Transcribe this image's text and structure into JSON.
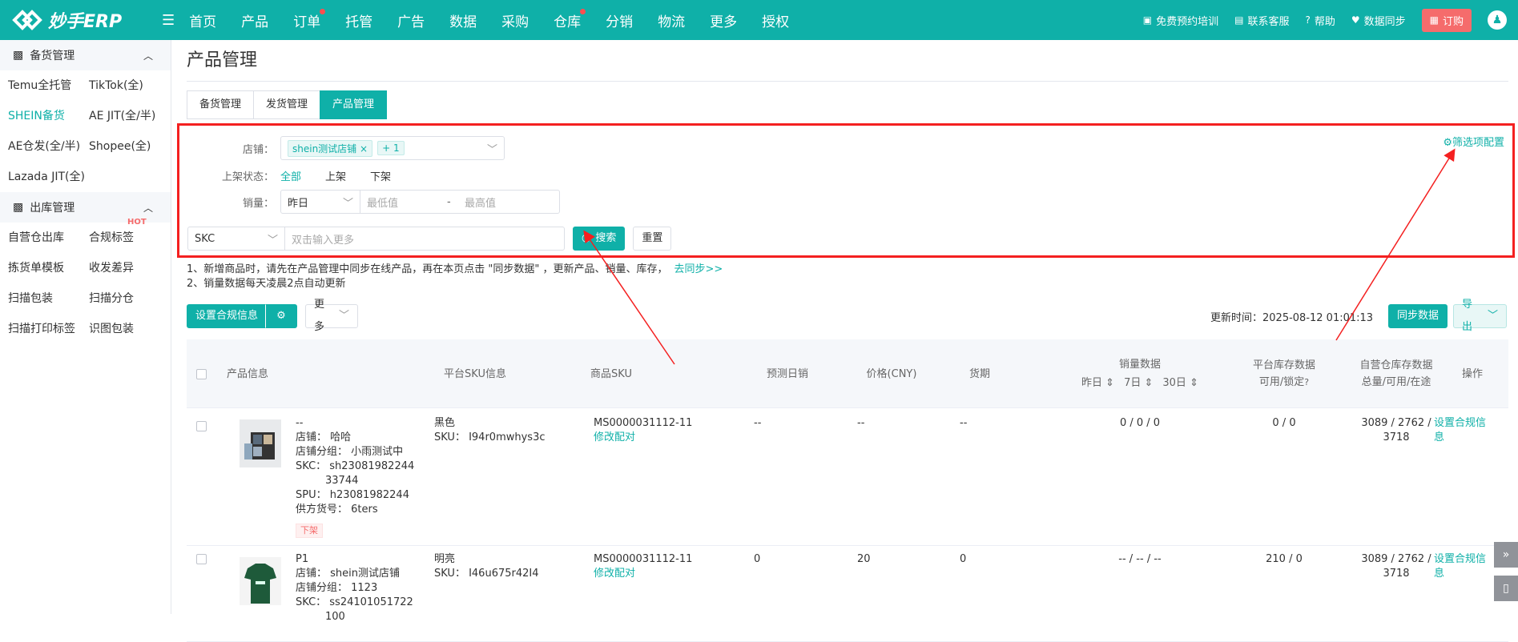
{
  "brand": {
    "name": "妙手ERP"
  },
  "nav": [
    "首页",
    "产品",
    "订单",
    "托管",
    "广告",
    "数据",
    "采购",
    "仓库",
    "分销",
    "物流",
    "更多",
    "授权"
  ],
  "top_right": {
    "training": "免费预约培训",
    "service": "联系客服",
    "help": "帮助",
    "sync": "数据同步",
    "order": "订购"
  },
  "sidebar": {
    "section1": {
      "title": "备货管理",
      "items": [
        "Temu全托管",
        "TikTok(全)",
        "SHEIN备货",
        "AE JIT(全/半)",
        "AE仓发(全/半)",
        "Shopee(全)",
        "Lazada JIT(全)"
      ]
    },
    "section2": {
      "title": "出库管理",
      "items": [
        "自营仓出库",
        "合规标签",
        "拣货单模板",
        "收发差异",
        "扫描包装",
        "扫描分仓",
        "扫描打印标签",
        "识图包装"
      ],
      "hot": "HOT"
    }
  },
  "page": {
    "title": "产品管理",
    "tabs": [
      "备货管理",
      "发货管理",
      "产品管理"
    ]
  },
  "filter": {
    "shop_label": "店铺：",
    "shop_tag": "shein测试店铺",
    "shop_more": "+ 1",
    "status_label": "上架状态：",
    "status_options": [
      "全部",
      "上架",
      "下架"
    ],
    "sales_label": "销量：",
    "sales_period": "昨日",
    "min_placeholder": "最低值",
    "range_sep": "-",
    "max_placeholder": "最高值",
    "search_type": "SKC",
    "search_placeholder": "双击输入更多",
    "search_btn": "搜索",
    "reset_btn": "重置",
    "config": "筛选项配置"
  },
  "notes": {
    "line1": "1、新增商品时，请先在产品管理中同步在线产品，再在本页点击 \"同步数据\" ，更新产品、销量、库存，",
    "line1_link": "去同步>>",
    "line2": "2、销量数据每天凌晨2点自动更新"
  },
  "toolbar": {
    "compliance": "设置合规信息",
    "more": "更多",
    "updated": "更新时间：2025-08-12 01:01:13",
    "sync_btn": "同步数据",
    "export_btn": "导出"
  },
  "table": {
    "headers": {
      "product": "产品信息",
      "platform_sku": "平台SKU信息",
      "goods_sku": "商品SKU",
      "forecast": "预测日销",
      "price": "价格(CNY)",
      "period": "货期",
      "sales": "销量数据",
      "sales_sub": [
        "昨日",
        "7日",
        "30日"
      ],
      "platform_stock": "平台库存数据",
      "platform_stock_sub": "可用/锁定",
      "own_stock": "自营仓库存数据",
      "own_stock_sub": "总量/可用/在途",
      "ops": "操作"
    },
    "rows": [
      {
        "name": "--",
        "shop": "店铺：  哈哈",
        "group": "店铺分组：  小雨测试中",
        "skc_a": "SKC：  sh23081982244",
        "skc_b": "33744",
        "spu": "SPU：  h23081982244",
        "supplier": "供方货号：  6ters",
        "status": "下架",
        "color": "黑色",
        "sku": "SKU：  I94r0mwhys3c",
        "goods_sku": "MS0000031112-11",
        "edit": "修改配对",
        "forecast": "--",
        "price": "--",
        "period": "--",
        "sales": "0 / 0 / 0",
        "pstock": "0 / 0",
        "ostock_a": "3089 / 2762 /",
        "ostock_b": "3718",
        "op_a": "设置合规信",
        "op_b": "息"
      },
      {
        "name": "P1",
        "shop": "店铺：  shein测试店铺",
        "group": "店铺分组：  1123",
        "skc_a": "SKC：  ss24101051722",
        "skc_b": "100",
        "color": "明亮",
        "sku": "SKU：  I46u675r42I4",
        "goods_sku": "MS0000031112-11",
        "edit": "修改配对",
        "forecast": "0",
        "price": "20",
        "period": "0",
        "sales": "-- / -- / --",
        "pstock": "210 / 0",
        "ostock_a": "3089 / 2762 /",
        "ostock_b": "3718",
        "op_a": "设置合规信",
        "op_b": "息"
      }
    ]
  },
  "colors": {
    "accent": "#0fb0a8",
    "highlight": "#f42020",
    "danger": "#f56c6c"
  }
}
